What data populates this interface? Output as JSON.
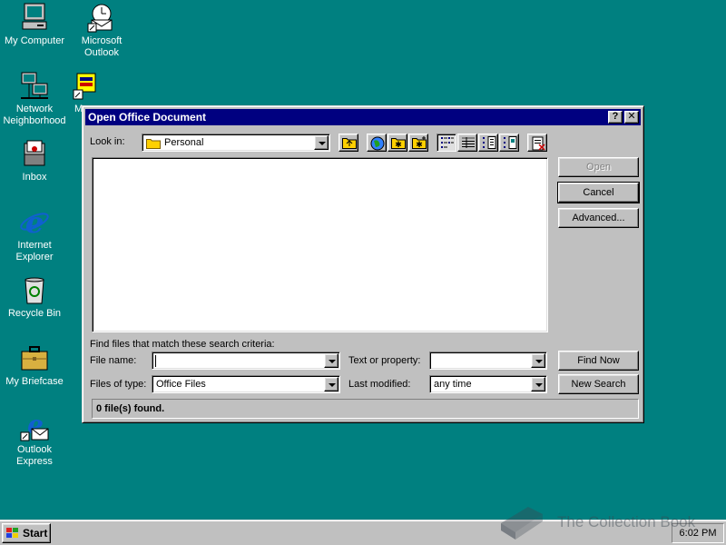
{
  "desktop": {
    "icons": [
      {
        "label": "My Computer"
      },
      {
        "label": "Microsoft Outlook"
      },
      {
        "label": "Network Neighborhood"
      },
      {
        "label": "M"
      },
      {
        "label": "Inbox"
      },
      {
        "label": "Internet Explorer"
      },
      {
        "label": "Recycle Bin"
      },
      {
        "label": "My Briefcase"
      },
      {
        "label": "Outlook Express"
      }
    ]
  },
  "dialog": {
    "title": "Open Office Document",
    "help_glyph": "?",
    "close_glyph": "✕",
    "look_in_label": "Look in:",
    "look_in_value": "Personal",
    "buttons": {
      "open": "Open",
      "cancel": "Cancel",
      "advanced": "Advanced...",
      "find_now": "Find Now",
      "new_search": "New Search"
    },
    "criteria_heading": "Find files that match these search criteria:",
    "file_name_label": "File name:",
    "file_name_value": "",
    "files_of_type_label": "Files of type:",
    "files_of_type_value": "Office Files",
    "text_property_label": "Text or property:",
    "text_property_value": "",
    "last_modified_label": "Last modified:",
    "last_modified_value": "any time",
    "status": "0 file(s) found."
  },
  "taskbar": {
    "start_label": "Start",
    "clock": "6:02 PM"
  },
  "watermark": "The Collection Book"
}
